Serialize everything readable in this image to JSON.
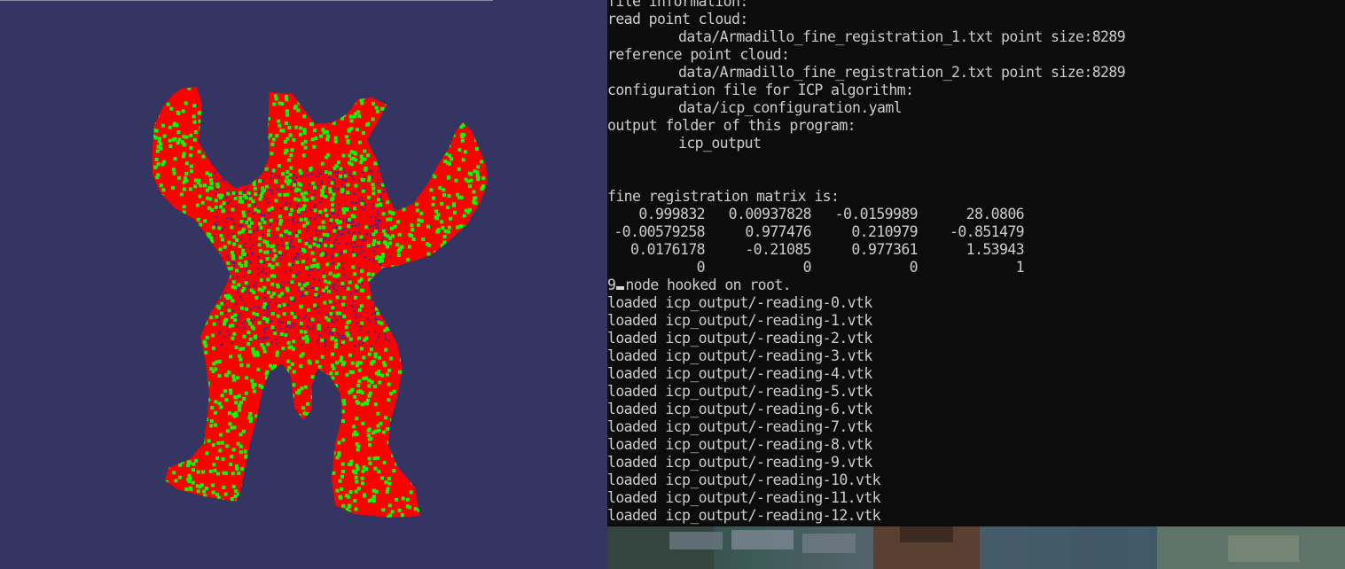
{
  "viewer": {
    "background": "#353564",
    "point_cloud": {
      "read_color": "#ff0000",
      "reference_color": "#00ff00",
      "inner_color": "#2a2ab0"
    }
  },
  "console": {
    "lines_top": [
      "file information:",
      "read point cloud:",
      "data/Armadillo_fine_registration_1.txt point size:8289",
      "reference point cloud:",
      "data/Armadillo_fine_registration_2.txt point size:8289",
      "configuration file for ICP algorithm:",
      "data/icp_configuration.yaml",
      "output folder of this program:",
      "icp_output",
      "",
      "",
      "fine registration matrix is:"
    ],
    "matrix": [
      [
        "0.999832",
        "0.00937828",
        "-0.0159989",
        "28.0806"
      ],
      [
        "-0.00579258",
        "0.977476",
        "0.210979",
        "-0.851479"
      ],
      [
        "0.0176178",
        "-0.21085",
        "0.977361",
        "1.53943"
      ],
      [
        "0",
        "0",
        "0",
        "1"
      ]
    ],
    "hook_prefix": "9",
    "hook_text": "node hooked on root.",
    "loaded_lines": [
      "loaded icp_output/-reading-0.vtk",
      "loaded icp_output/-reading-1.vtk",
      "loaded icp_output/-reading-2.vtk",
      "loaded icp_output/-reading-3.vtk",
      "loaded icp_output/-reading-4.vtk",
      "loaded icp_output/-reading-5.vtk",
      "loaded icp_output/-reading-6.vtk",
      "loaded icp_output/-reading-7.vtk",
      "loaded icp_output/-reading-8.vtk",
      "loaded icp_output/-reading-9.vtk",
      "loaded icp_output/-reading-10.vtk",
      "loaded icp_output/-reading-11.vtk",
      "loaded icp_output/-reading-12.vtk"
    ]
  }
}
